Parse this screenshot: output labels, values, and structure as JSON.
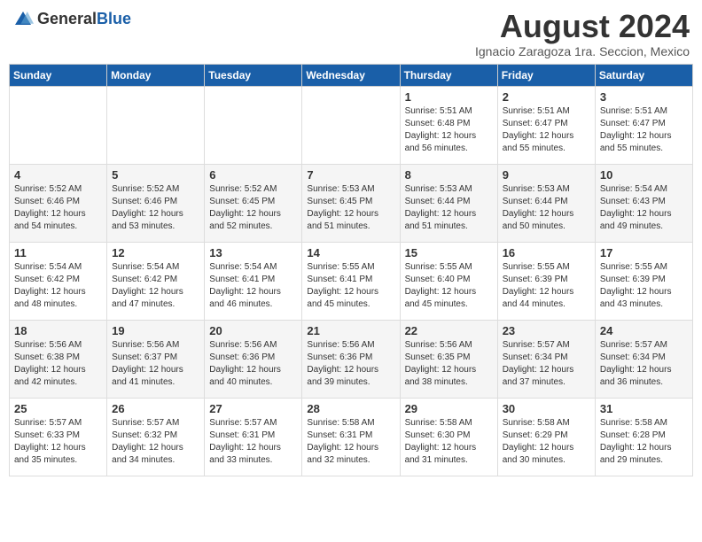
{
  "logo": {
    "general": "General",
    "blue": "Blue"
  },
  "header": {
    "month": "August 2024",
    "location": "Ignacio Zaragoza 1ra. Seccion, Mexico"
  },
  "days_of_week": [
    "Sunday",
    "Monday",
    "Tuesday",
    "Wednesday",
    "Thursday",
    "Friday",
    "Saturday"
  ],
  "weeks": [
    [
      {
        "day": "",
        "content": ""
      },
      {
        "day": "",
        "content": ""
      },
      {
        "day": "",
        "content": ""
      },
      {
        "day": "",
        "content": ""
      },
      {
        "day": "1",
        "content": "Sunrise: 5:51 AM\nSunset: 6:48 PM\nDaylight: 12 hours\nand 56 minutes."
      },
      {
        "day": "2",
        "content": "Sunrise: 5:51 AM\nSunset: 6:47 PM\nDaylight: 12 hours\nand 55 minutes."
      },
      {
        "day": "3",
        "content": "Sunrise: 5:51 AM\nSunset: 6:47 PM\nDaylight: 12 hours\nand 55 minutes."
      }
    ],
    [
      {
        "day": "4",
        "content": "Sunrise: 5:52 AM\nSunset: 6:46 PM\nDaylight: 12 hours\nand 54 minutes."
      },
      {
        "day": "5",
        "content": "Sunrise: 5:52 AM\nSunset: 6:46 PM\nDaylight: 12 hours\nand 53 minutes."
      },
      {
        "day": "6",
        "content": "Sunrise: 5:52 AM\nSunset: 6:45 PM\nDaylight: 12 hours\nand 52 minutes."
      },
      {
        "day": "7",
        "content": "Sunrise: 5:53 AM\nSunset: 6:45 PM\nDaylight: 12 hours\nand 51 minutes."
      },
      {
        "day": "8",
        "content": "Sunrise: 5:53 AM\nSunset: 6:44 PM\nDaylight: 12 hours\nand 51 minutes."
      },
      {
        "day": "9",
        "content": "Sunrise: 5:53 AM\nSunset: 6:44 PM\nDaylight: 12 hours\nand 50 minutes."
      },
      {
        "day": "10",
        "content": "Sunrise: 5:54 AM\nSunset: 6:43 PM\nDaylight: 12 hours\nand 49 minutes."
      }
    ],
    [
      {
        "day": "11",
        "content": "Sunrise: 5:54 AM\nSunset: 6:42 PM\nDaylight: 12 hours\nand 48 minutes."
      },
      {
        "day": "12",
        "content": "Sunrise: 5:54 AM\nSunset: 6:42 PM\nDaylight: 12 hours\nand 47 minutes."
      },
      {
        "day": "13",
        "content": "Sunrise: 5:54 AM\nSunset: 6:41 PM\nDaylight: 12 hours\nand 46 minutes."
      },
      {
        "day": "14",
        "content": "Sunrise: 5:55 AM\nSunset: 6:41 PM\nDaylight: 12 hours\nand 45 minutes."
      },
      {
        "day": "15",
        "content": "Sunrise: 5:55 AM\nSunset: 6:40 PM\nDaylight: 12 hours\nand 45 minutes."
      },
      {
        "day": "16",
        "content": "Sunrise: 5:55 AM\nSunset: 6:39 PM\nDaylight: 12 hours\nand 44 minutes."
      },
      {
        "day": "17",
        "content": "Sunrise: 5:55 AM\nSunset: 6:39 PM\nDaylight: 12 hours\nand 43 minutes."
      }
    ],
    [
      {
        "day": "18",
        "content": "Sunrise: 5:56 AM\nSunset: 6:38 PM\nDaylight: 12 hours\nand 42 minutes."
      },
      {
        "day": "19",
        "content": "Sunrise: 5:56 AM\nSunset: 6:37 PM\nDaylight: 12 hours\nand 41 minutes."
      },
      {
        "day": "20",
        "content": "Sunrise: 5:56 AM\nSunset: 6:36 PM\nDaylight: 12 hours\nand 40 minutes."
      },
      {
        "day": "21",
        "content": "Sunrise: 5:56 AM\nSunset: 6:36 PM\nDaylight: 12 hours\nand 39 minutes."
      },
      {
        "day": "22",
        "content": "Sunrise: 5:56 AM\nSunset: 6:35 PM\nDaylight: 12 hours\nand 38 minutes."
      },
      {
        "day": "23",
        "content": "Sunrise: 5:57 AM\nSunset: 6:34 PM\nDaylight: 12 hours\nand 37 minutes."
      },
      {
        "day": "24",
        "content": "Sunrise: 5:57 AM\nSunset: 6:34 PM\nDaylight: 12 hours\nand 36 minutes."
      }
    ],
    [
      {
        "day": "25",
        "content": "Sunrise: 5:57 AM\nSunset: 6:33 PM\nDaylight: 12 hours\nand 35 minutes."
      },
      {
        "day": "26",
        "content": "Sunrise: 5:57 AM\nSunset: 6:32 PM\nDaylight: 12 hours\nand 34 minutes."
      },
      {
        "day": "27",
        "content": "Sunrise: 5:57 AM\nSunset: 6:31 PM\nDaylight: 12 hours\nand 33 minutes."
      },
      {
        "day": "28",
        "content": "Sunrise: 5:58 AM\nSunset: 6:31 PM\nDaylight: 12 hours\nand 32 minutes."
      },
      {
        "day": "29",
        "content": "Sunrise: 5:58 AM\nSunset: 6:30 PM\nDaylight: 12 hours\nand 31 minutes."
      },
      {
        "day": "30",
        "content": "Sunrise: 5:58 AM\nSunset: 6:29 PM\nDaylight: 12 hours\nand 30 minutes."
      },
      {
        "day": "31",
        "content": "Sunrise: 5:58 AM\nSunset: 6:28 PM\nDaylight: 12 hours\nand 29 minutes."
      }
    ]
  ]
}
